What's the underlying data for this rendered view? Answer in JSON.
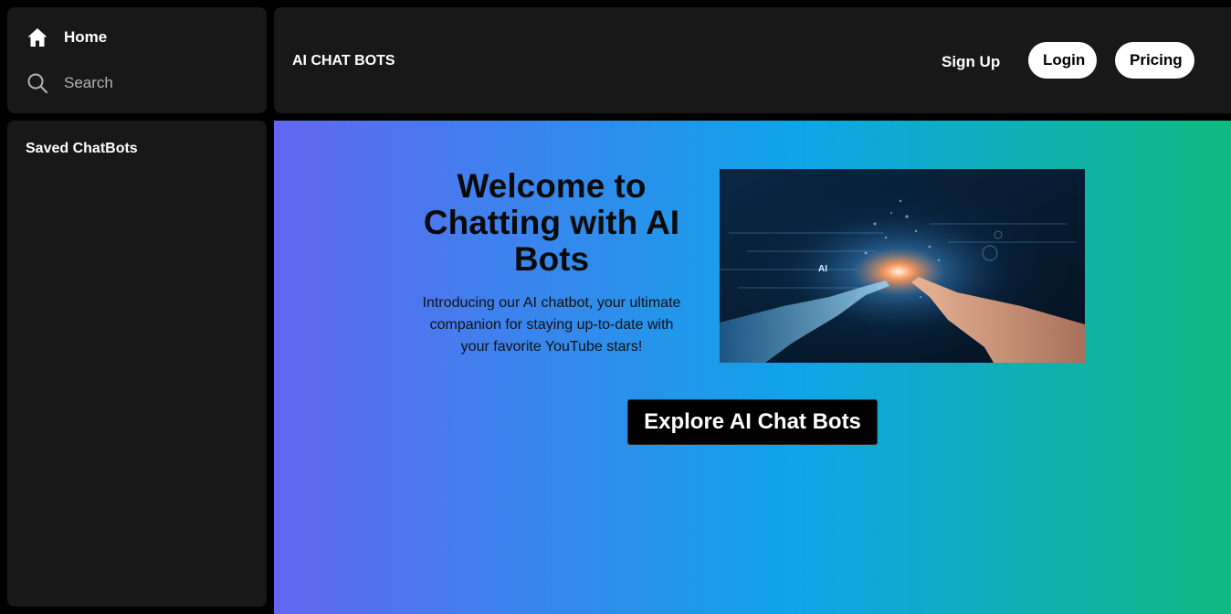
{
  "sidebar": {
    "nav": [
      {
        "label": "Home",
        "icon": "home-icon"
      },
      {
        "label": "Search",
        "icon": "search-icon"
      }
    ],
    "saved_title": "Saved ChatBots"
  },
  "header": {
    "brand": "AI CHAT BOTS",
    "signup_label": "Sign Up",
    "login_label": "Login",
    "pricing_label": "Pricing"
  },
  "hero": {
    "title": "Welcome to Chatting with AI Bots",
    "description": "Introducing our AI chatbot, your ultimate companion for staying up-to-date with your favorite YouTube stars!",
    "image_text": "AI",
    "cta_label": "Explore AI Chat Bots"
  },
  "colors": {
    "panel": "#181818",
    "gradient_start": "#6366f1",
    "gradient_mid": "#0ea5e9",
    "gradient_end": "#10b981"
  }
}
